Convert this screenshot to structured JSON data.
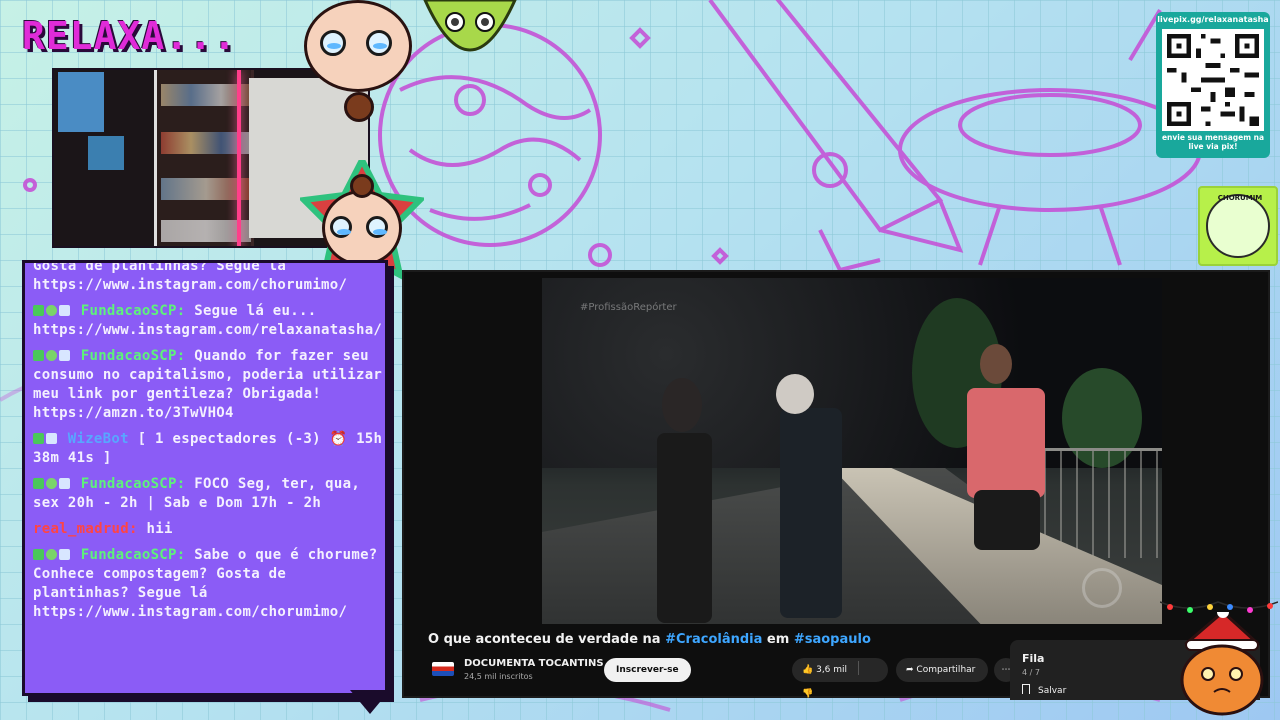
{
  "overlay": {
    "title": "RELAXA..."
  },
  "qr": {
    "top_text": "livepix.gg/relaxanatasha",
    "bottom_text": "envie sua mensagem na live via pix!"
  },
  "sponsor_logo": {
    "text": "CHORUMIM"
  },
  "chat": {
    "messages": [
      {
        "user": "",
        "text": "Gosta de plantinhas? Segue lá https://www.instagram.com/chorumimo/"
      },
      {
        "user": "FundacaoSCP:",
        "text": "Segue lá eu... https://www.instagram.com/relaxanatasha/"
      },
      {
        "user": "FundacaoSCP:",
        "text": "Quando for fazer seu consumo no capitalismo, poderia utilizar meu link por gentileza? Obrigada! https://amzn.to/3TwVHO4"
      },
      {
        "user": "WizeBot",
        "text": "[ 1 espectadores (-3) ⏰ 15h 38m 41s ]"
      },
      {
        "user": "FundacaoSCP:",
        "text": "FOCO Seg, ter, qua, sex 20h - 2h | Sab e Dom 17h - 2h"
      },
      {
        "user": "real_madrud:",
        "text": "hii"
      },
      {
        "user": "FundacaoSCP:",
        "text": "Sabe o que é chorume? Conhece compostagem? Gosta de plantinhas? Segue lá https://www.instagram.com/chorumimo/"
      }
    ]
  },
  "video": {
    "watermark": "#ProfissãoRepórter",
    "title_prefix": "O que aconteceu de verdade na ",
    "tag1": "#Cracolândia",
    "title_middle": " em ",
    "tag2": "#saopaulo",
    "channel_name": "DOCUMENTA TOCANTINS",
    "channel_subs": "24,5 mil inscritos",
    "subscribe_label": "Inscrever-se",
    "likes": "3,6 mil",
    "share_label": "Compartilhar",
    "more_label": "⋯"
  },
  "queue": {
    "title": "Fila",
    "count": "4 / 7",
    "save_label": "Salvar"
  },
  "colors": {
    "chat_bg": "#8b5cf6",
    "title_color": "#e02bd8",
    "youtube_link": "#3ea6ff"
  }
}
